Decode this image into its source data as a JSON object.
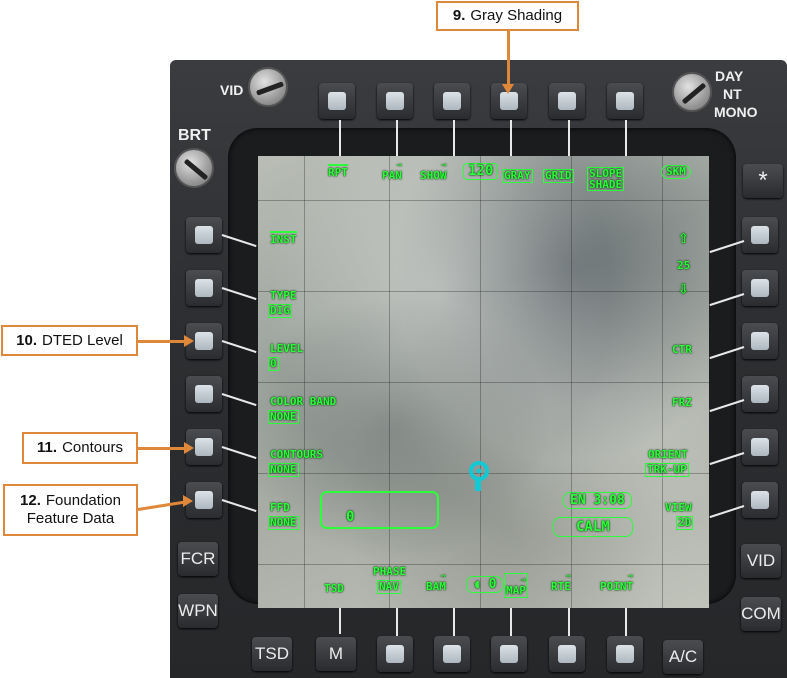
{
  "callouts": {
    "gray_shading": {
      "num": "9.",
      "text": "Gray Shading"
    },
    "dted_level": {
      "num": "10.",
      "text": "DTED Level"
    },
    "contours": {
      "num": "11.",
      "text": "Contours"
    },
    "ffd": {
      "num": "12.",
      "text": "Foundation",
      "text2": "Feature Data"
    }
  },
  "panel": {
    "vid_knob": "VID",
    "brt_knob": "BRT",
    "mode_day": "DAY",
    "mode_nt": "NT",
    "mode_mono": "MONO",
    "star": "*",
    "fcr": "FCR",
    "wpn": "WPN",
    "vid_btn": "VID",
    "com": "COM",
    "tsd_btn": "TSD",
    "m_btn": "M",
    "ac_btn": "A/C"
  },
  "top": {
    "rpt": "RPT",
    "pan": "PAN",
    "show": "SHOW",
    "scale": "120",
    "gray": "GRAY",
    "grid": "GRID",
    "slope1": "SLOPE",
    "slope2": "SHADE",
    "skm": "SKM"
  },
  "left": {
    "inst": "INST",
    "type_label": "TYPE",
    "type_val": "DIG",
    "level_label": "LEVEL",
    "level_val": "0",
    "color_label": "COLOR BAND",
    "color_val": "NONE",
    "contours_label": "CONTOURS",
    "contours_val": "NONE",
    "ffd_label": "FFD",
    "ffd_val": "NONE"
  },
  "right": {
    "up": "⇧",
    "range": "25",
    "down": "⇩",
    "ctr": "CTR",
    "frz": "FRZ",
    "orient_label": "ORIENT",
    "orient_val": "TRK-UP",
    "view_label": "VIEW",
    "view_val": "2D"
  },
  "bottom": {
    "tsd": "TSD",
    "phase_label": "PHASE",
    "phase_val": "NAV",
    "bam": "BAM",
    "zero": "0",
    "map": "MAP",
    "rte": "RTE",
    "point": "POINT"
  },
  "center": {
    "scratch": "0",
    "clock": "EN 3:08",
    "wind": "CALM"
  }
}
